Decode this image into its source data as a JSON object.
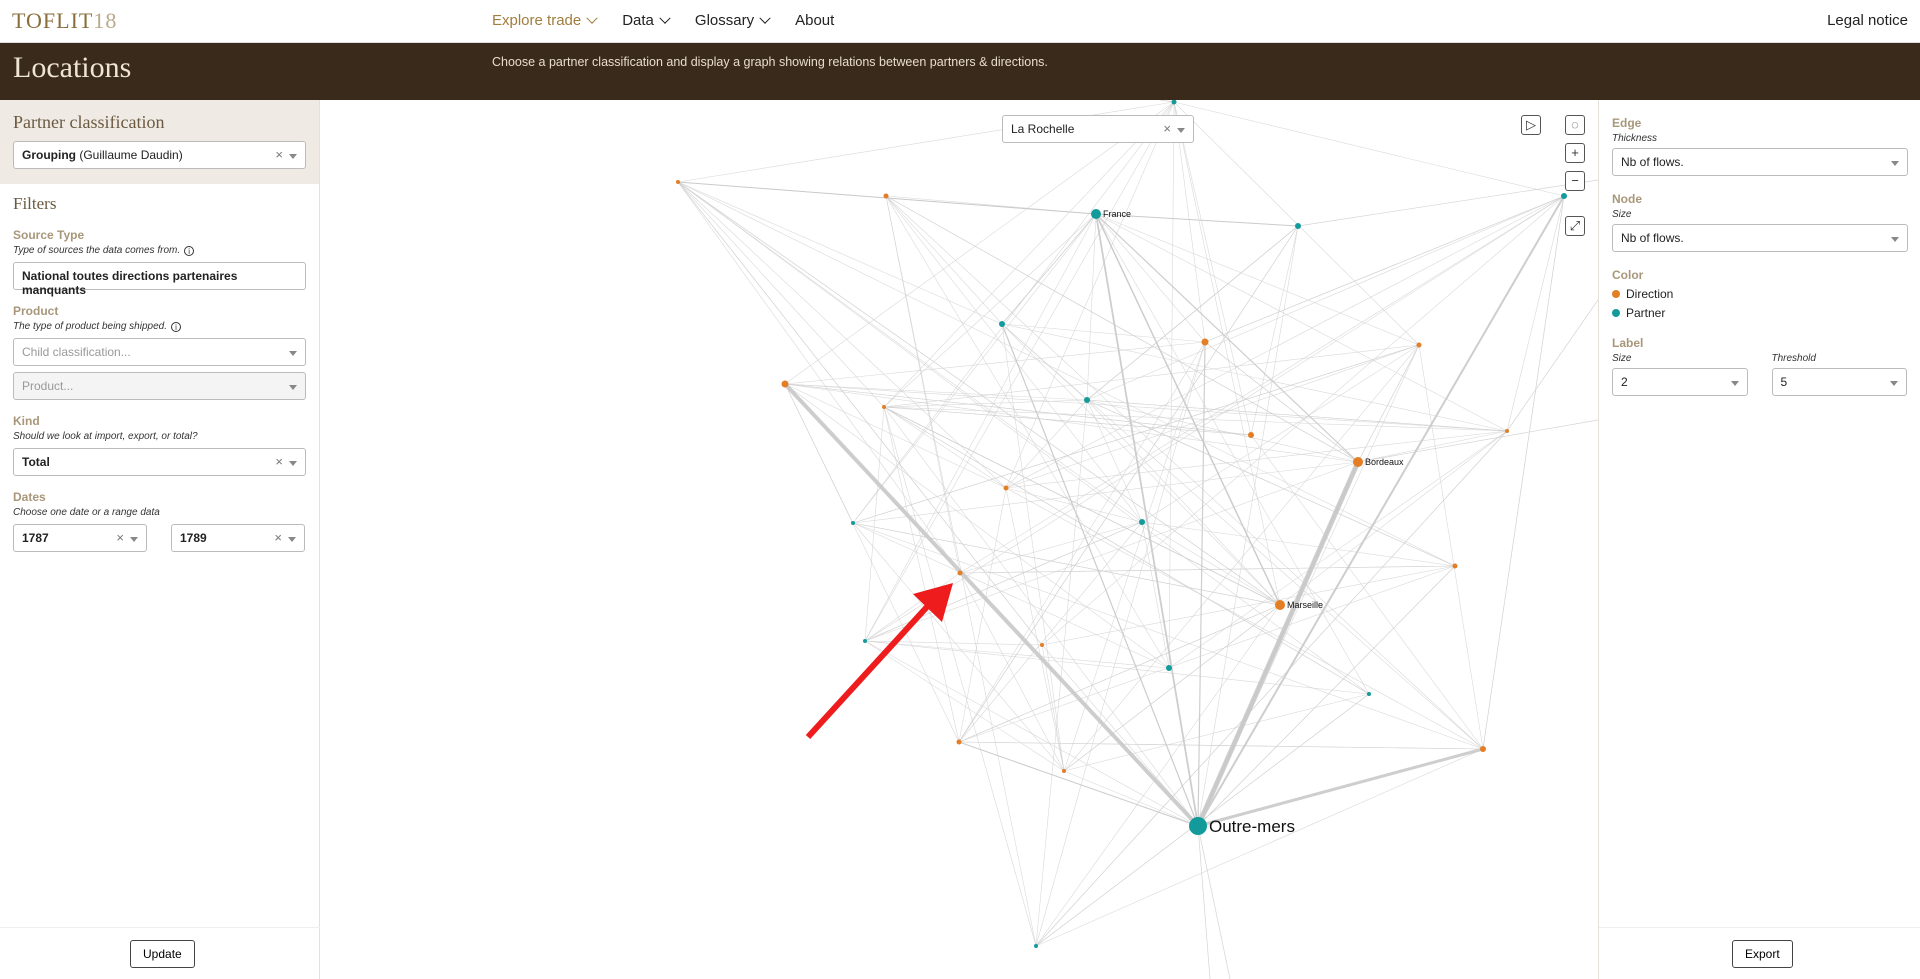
{
  "nav": {
    "logo_text": "TOFLIT",
    "logo_num": "18",
    "items": [
      {
        "label": "Explore trade",
        "dropdown": true,
        "active": true
      },
      {
        "label": "Data",
        "dropdown": true
      },
      {
        "label": "Glossary",
        "dropdown": true
      },
      {
        "label": "About",
        "dropdown": false
      }
    ],
    "legal": "Legal notice"
  },
  "header": {
    "title": "Locations",
    "subtitle": "Choose a partner classification and display a graph showing relations between partners & directions."
  },
  "left": {
    "partner_title": "Partner classification",
    "partner_bold": "Grouping",
    "partner_rest": " (Guillaume Daudin)",
    "filters_title": "Filters",
    "source_type_label": "Source Type",
    "source_type_help": "Type of sources the data comes from.",
    "source_type_value": "National toutes directions partenaires manquants",
    "product_label": "Product",
    "product_help": "The type of product being shipped.",
    "child_placeholder": "Child classification...",
    "product_placeholder": "Product...",
    "kind_label": "Kind",
    "kind_help": "Should we look at import, export, or total?",
    "kind_value": "Total",
    "dates_label": "Dates",
    "dates_help": "Choose one date or a range data",
    "date_from": "1787",
    "date_to": "1789",
    "update_button": "Update"
  },
  "graph": {
    "node_search": "La Rochelle",
    "labels": {
      "france": "France",
      "bordeaux": "Bordeaux",
      "marseille": "Marseille",
      "outremers": "Outre-mers"
    },
    "colors": {
      "direction": "#e37e25",
      "partner": "#139b9b",
      "edge": "#cfcfcf",
      "arrow": "#ee1c1c"
    }
  },
  "right": {
    "edge_label": "Edge",
    "thickness_label": "Thickness",
    "thickness_value": "Nb of flows.",
    "node_label": "Node",
    "size_label": "Size",
    "size_value": "Nb of flows.",
    "color_label": "Color",
    "legend_direction": "Direction",
    "legend_partner": "Partner",
    "label_label": "Label",
    "label_size_label": "Size",
    "label_size_value": "2",
    "threshold_label": "Threshold",
    "threshold_value": "5",
    "export_button": "Export"
  }
}
